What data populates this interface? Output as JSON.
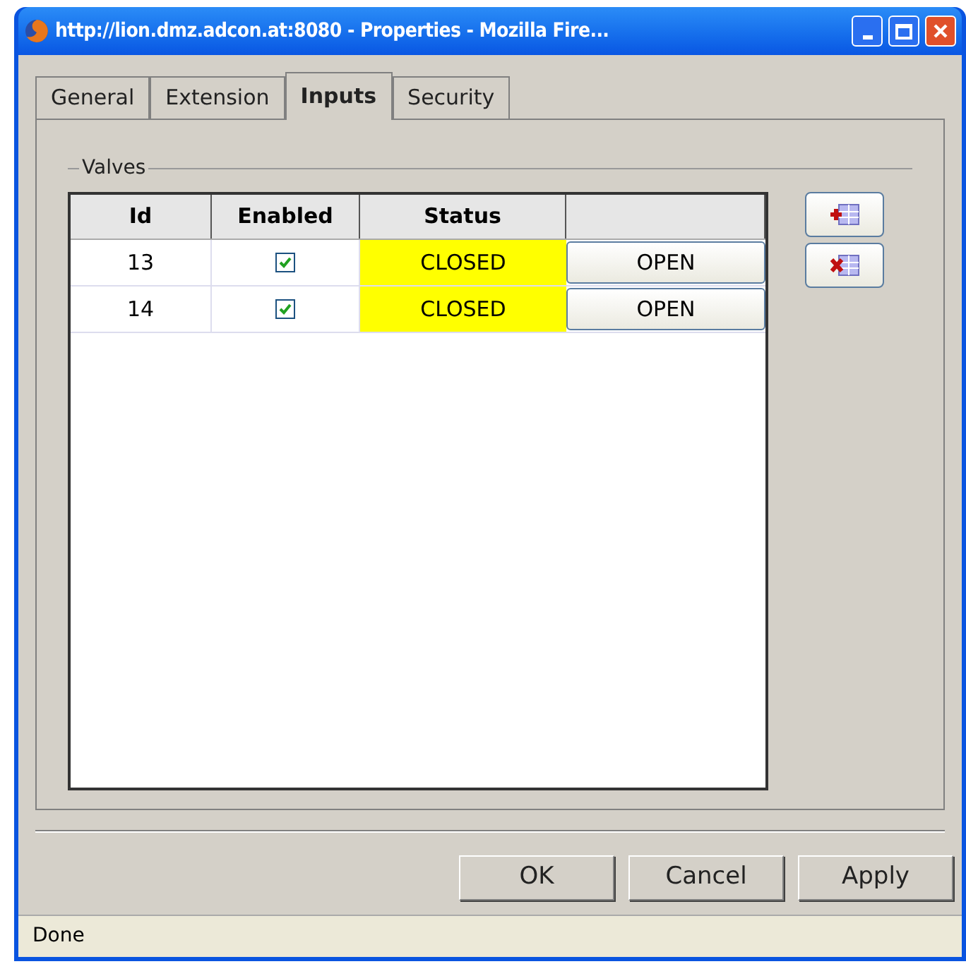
{
  "window": {
    "title": "http://lion.dmz.adcon.at:8080 - Properties - Mozilla Fire..."
  },
  "tabs": [
    {
      "label": "General",
      "selected": false
    },
    {
      "label": "Extension",
      "selected": false
    },
    {
      "label": "Inputs",
      "selected": true
    },
    {
      "label": "Security",
      "selected": false
    }
  ],
  "group": {
    "title": "Valves"
  },
  "table": {
    "columns": [
      "Id",
      "Enabled",
      "Status"
    ],
    "rows": [
      {
        "id": "13",
        "enabled": true,
        "status": "CLOSED",
        "action": "OPEN"
      },
      {
        "id": "14",
        "enabled": true,
        "status": "CLOSED",
        "action": "OPEN"
      }
    ]
  },
  "buttons": [
    "OK",
    "Cancel",
    "Apply"
  ],
  "status_bar": "Done"
}
